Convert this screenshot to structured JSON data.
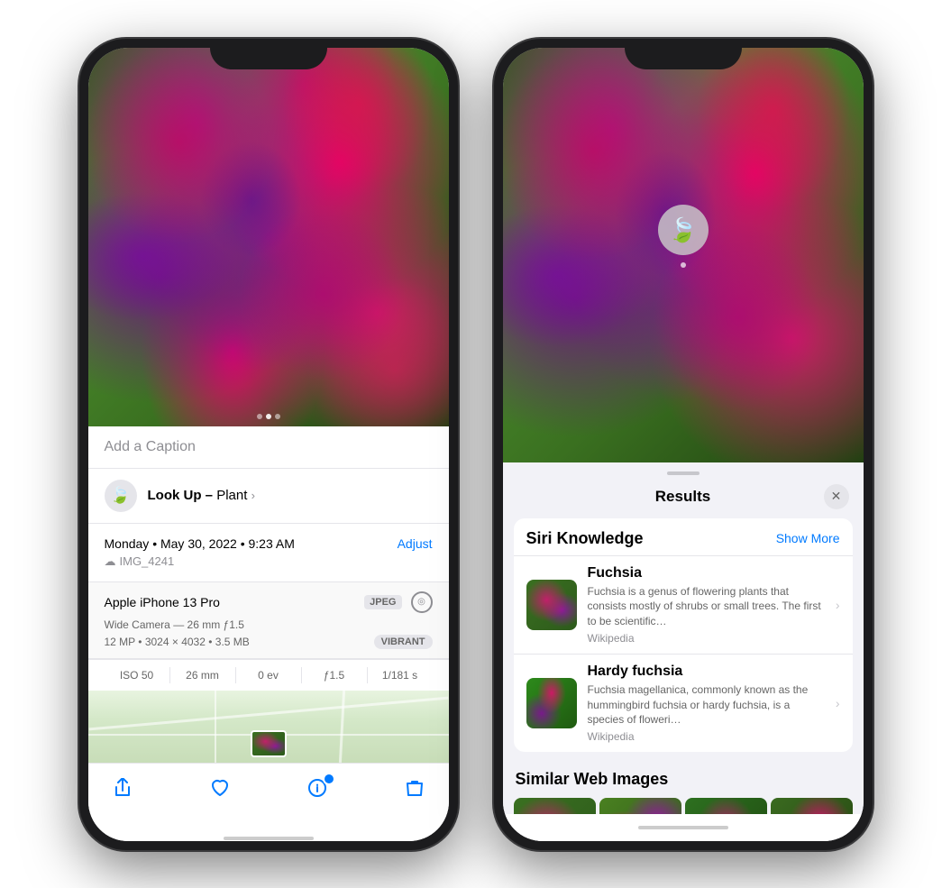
{
  "leftPhone": {
    "caption": {
      "placeholder": "Add a Caption"
    },
    "lookUp": {
      "label": "Look Up –",
      "subject": "Plant",
      "chevron": "›"
    },
    "metadata": {
      "date": "Monday • May 30, 2022 • 9:23 AM",
      "adjust": "Adjust",
      "cloudIcon": "☁",
      "filename": "IMG_4241"
    },
    "device": {
      "name": "Apple iPhone 13 Pro",
      "format": "JPEG",
      "camera": "Wide Camera — 26 mm ƒ1.5",
      "resolution": "12 MP • 3024 × 4032 • 3.5 MB",
      "filter": "VIBRANT"
    },
    "exif": {
      "iso": "ISO 50",
      "focal": "26 mm",
      "ev": "0 ev",
      "aperture": "ƒ1.5",
      "shutter": "1/181 s"
    },
    "toolbar": {
      "share": "↑",
      "favorite": "♡",
      "info": "ⓘ",
      "delete": "🗑"
    }
  },
  "rightPhone": {
    "siriLeaf": "🍃",
    "results": {
      "title": "Results",
      "closeLabel": "✕",
      "siriKnowledge": {
        "sectionTitle": "Siri Knowledge",
        "showMore": "Show More",
        "items": [
          {
            "name": "Fuchsia",
            "description": "Fuchsia is a genus of flowering plants that consists mostly of shrubs or small trees. The first to be scientific…",
            "source": "Wikipedia",
            "chevron": "›"
          },
          {
            "name": "Hardy fuchsia",
            "description": "Fuchsia magellanica, commonly known as the hummingbird fuchsia or hardy fuchsia, is a species of floweri…",
            "source": "Wikipedia",
            "chevron": "›"
          }
        ]
      },
      "similarWebImages": {
        "sectionTitle": "Similar Web Images"
      }
    }
  }
}
